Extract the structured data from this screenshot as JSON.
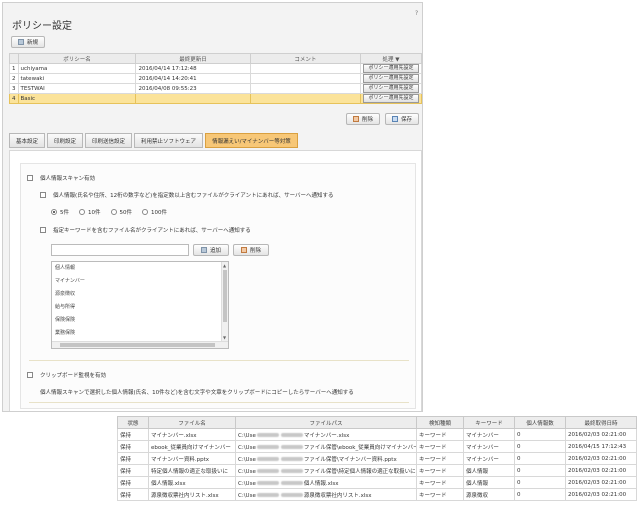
{
  "header": {
    "title": "ポリシー設定",
    "help": "?"
  },
  "toolbar": {
    "new_label": "新規"
  },
  "policy_table": {
    "columns": [
      "",
      "ポリシー名",
      "最終更新日",
      "コメント",
      "処理 ▼"
    ],
    "rows": [
      {
        "no": "1",
        "name": "uchiyama",
        "updated": "2016/04/14 17:12:48",
        "comment": "",
        "action": "ポリシー適用先設定"
      },
      {
        "no": "2",
        "name": "tatewaki",
        "updated": "2016/04/14 14:20:41",
        "comment": "",
        "action": "ポリシー適用先設定"
      },
      {
        "no": "3",
        "name": "TESTWAI",
        "updated": "2016/04/08 09:55:23",
        "comment": "",
        "action": "ポリシー適用先設定"
      },
      {
        "no": "4",
        "name": "Basic",
        "updated": "",
        "comment": "",
        "action": "ポリシー適用先設定"
      }
    ]
  },
  "actions": {
    "delete_label": "削除",
    "save_label": "保存"
  },
  "tabs": [
    "基本設定",
    "印刷設定",
    "印刷送信設定",
    "利用禁止ソフトウェア",
    "情報漏えい/マイナンバー等対策"
  ],
  "settings": {
    "scan_enable": "個人情報スキャン有効",
    "notify_personal": "個人情報(氏名や住所、12桁の数字など)を指定数以上含むファイルがクライアントにあれば、サーバーへ通知する",
    "radio_options": [
      "5件",
      "10件",
      "50件",
      "100件"
    ],
    "notify_keyword": "指定キーワードを含むファイル名がクライアントにあれば、サーバーへ通知する",
    "add_label": "追加",
    "remove_label": "削除",
    "keyword_placeholder": "",
    "keywords": [
      "個人情報",
      "マイナンバー",
      "源泉徴収",
      "給与所得",
      "保険保険",
      "業務保険"
    ],
    "clipboard_enable": "クリップボード監視を有効",
    "clipboard_desc": "個人情報スキャンで選択した個人情報(氏名、10件など)を含む文字や文章をクリップボードにコピーしたらサーバーへ通知する"
  },
  "log_table": {
    "columns": [
      "状態",
      "ファイル名",
      "ファイルパス",
      "検知種類",
      "キーワード",
      "個人情報数",
      "最終取得日時"
    ],
    "rows": [
      {
        "status": "保持",
        "file": "マイナンバー.xlsx",
        "path_pre": "C:\\Use",
        "path_post": "マイナンバー.xlsx",
        "type": "キーワード",
        "keyword": "マイナンバー",
        "count": "0",
        "date": "2016/02/03 02:21:00"
      },
      {
        "status": "保持",
        "file": "ebook_従業員向けマイナンバー",
        "path_pre": "C:\\Use",
        "path_post": "ファイル保管\\ebook_従業員向けマイナンバー",
        "type": "キーワード",
        "keyword": "マイナンバー",
        "count": "0",
        "date": "2016/04/15 17:12:43"
      },
      {
        "status": "保持",
        "file": "マイナンバー資料.pptx",
        "path_pre": "C:\\Use",
        "path_post": "ファイル保管\\マイナンバー資料.pptx",
        "type": "キーワード",
        "keyword": "マイナンバー",
        "count": "0",
        "date": "2016/02/03 02:21:00"
      },
      {
        "status": "保持",
        "file": "特定個人情報の適正な取扱いに",
        "path_pre": "C:\\Use",
        "path_post": "ファイル保管\\特定個人情報の適正な取扱いに",
        "type": "キーワード",
        "keyword": "個人情報",
        "count": "0",
        "date": "2016/02/03 02:21:00"
      },
      {
        "status": "保持",
        "file": "個人情報.xlsx",
        "path_pre": "C:\\Use",
        "path_post": "個人情報.xlsx",
        "type": "キーワード",
        "keyword": "個人情報",
        "count": "0",
        "date": "2016/02/03 02:21:00"
      },
      {
        "status": "保持",
        "file": "源泉徴収票社内リスト.xlsx",
        "path_pre": "C:\\Use",
        "path_post": "源泉徴収票社内リスト.xlsx",
        "type": "キーワード",
        "keyword": "源泉徴収",
        "count": "0",
        "date": "2016/02/03 02:21:00"
      }
    ]
  },
  "colors": {
    "selected_row": "#fbe39a",
    "active_tab": "#f7c777",
    "panel_bg": "#f3f3f3"
  }
}
